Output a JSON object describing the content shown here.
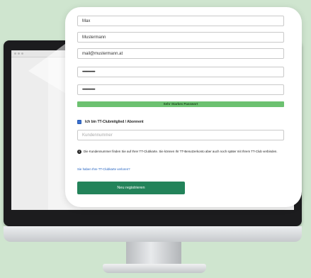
{
  "form": {
    "first_name": "Max",
    "last_name": "Mustermann",
    "email": "mail@mustermann.at",
    "password": "••••••••••••••••",
    "password_repeat": "••••••••••••••••",
    "strength_label": "Sehr Starkes Passwort",
    "member_checkbox_label": "Ich bin TT-Clubmitglied / Abonnent",
    "member_checked": true,
    "customer_number_placeholder": "Kundennummer",
    "info_text": "Die Kundennummer finden Sie auf Ihrer TT-Clubkarte. Sie können Ihr TT-Benutzerkonto aber auch noch später mit Ihrem TT-Club verbinden.",
    "forgot_link": "Sie haben Ihre TT-Clubkarte verloren?",
    "register_button": "Neu registrieren"
  },
  "colors": {
    "background": "#cfe5cf",
    "strength_bar": "#6cc170",
    "register_button": "#23835a",
    "link": "#1f5fbf"
  }
}
